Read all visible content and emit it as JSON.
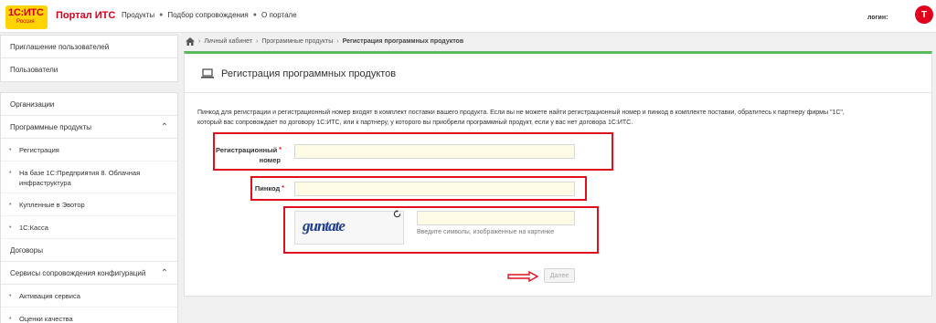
{
  "header": {
    "logo_line1": "1С:ИТС",
    "logo_line2": "Россия",
    "portal_title": "Портал ИТС",
    "nav": [
      "Продукты",
      "Подбор сопровождения",
      "О портале"
    ],
    "login_label": "логин:",
    "avatar_letter": "Т",
    "avatar_color": "#e0001b"
  },
  "sidebar": {
    "group1": [
      "Приглашение пользователей",
      "Пользователи"
    ],
    "organizations": "Организации",
    "programs": "Программные продукты",
    "programs_sub": [
      "Регистрация",
      "На базе 1С:Предприятия 8. Облачная инфраструктура",
      "Купленные в Эвотор",
      "1С:Касса"
    ],
    "contracts": "Договоры",
    "services": "Сервисы сопровождения конфигураций",
    "services_sub": [
      "Активация сервиса",
      "Оценки качества"
    ]
  },
  "breadcrumb": {
    "items": [
      "Личный кабинет",
      "Программные продукты",
      "Регистрация программных продуктов"
    ]
  },
  "panel": {
    "title": "Регистрация программных продуктов",
    "accent_color": "#5cb85c",
    "intro_line1": "Пинкод для регистрации и регистрационный номер входят в комплект поставки вашего продукта. Если вы не можете найти регистрационный номер и пинкод в комплекте поставки, обратитесь к партнеру фирмы \"1С\",",
    "intro_line2": "который вас сопровождает по договору 1С:ИТС, или к партнеру, у которого вы приобрели программный продукт, если у вас нет договора 1С:ИТС."
  },
  "form": {
    "reg_label_line1": "Регистрационный",
    "reg_label_line2": "номер",
    "reg_value": "",
    "pin_label": "Пинкод",
    "pin_value": "",
    "required_mark": "*",
    "captcha_text": "guntate",
    "captcha_value": "",
    "captcha_hint": "Введите символы, изображенные на картинке",
    "next_button": "Далее"
  },
  "highlight_color": "#e0101e"
}
